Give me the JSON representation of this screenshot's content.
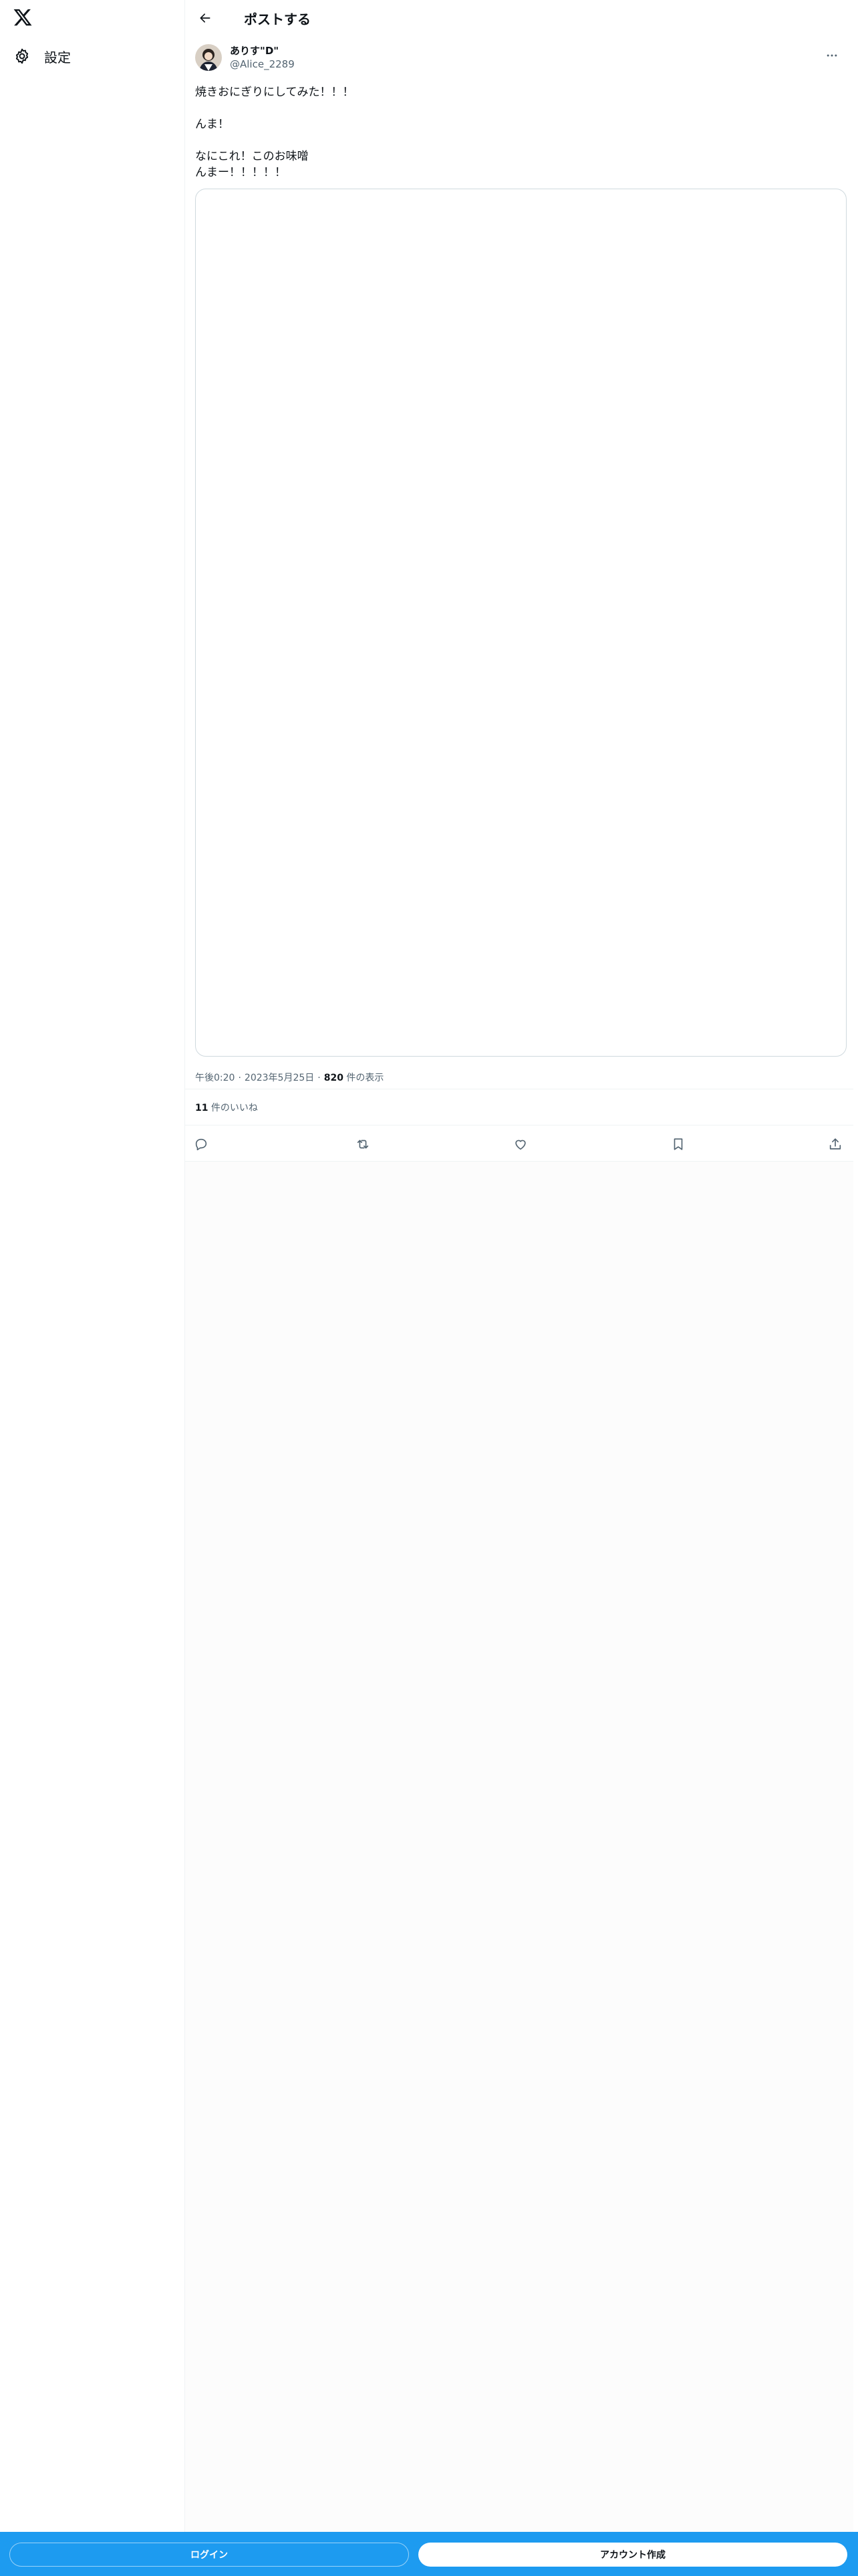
{
  "sidebar": {
    "logo_icon": "x-logo-icon",
    "settings_icon": "gear-icon",
    "settings_label": "設定"
  },
  "header": {
    "back_icon": "arrow-left-icon",
    "title": "ポストする"
  },
  "tweet": {
    "author_name": "ありす\"D\"",
    "author_handle": "@Alice_2289",
    "more_icon": "more-horizontal-icon",
    "text_lines": [
      "焼きおにぎりにしてみた！！！",
      "",
      "んま！",
      "",
      "なにこれ！このお味噌",
      "んまー！！！！！"
    ],
    "time": "午後0:20",
    "date": "2023年5月25日",
    "views_count": "820",
    "views_label": " 件の表示",
    "likes_count": "11",
    "likes_label": " 件のいいね"
  },
  "actions": {
    "reply_icon": "reply-icon",
    "retweet_icon": "retweet-icon",
    "like_icon": "heart-icon",
    "bookmark_icon": "bookmark-icon",
    "share_icon": "share-icon"
  },
  "bottom_bar": {
    "login_label": "ログイン",
    "signup_label": "アカウント作成"
  },
  "colors": {
    "accent": "#1d9bf0",
    "text": "#0f1419",
    "secondary_text": "#536471",
    "border": "#eff3f4"
  }
}
